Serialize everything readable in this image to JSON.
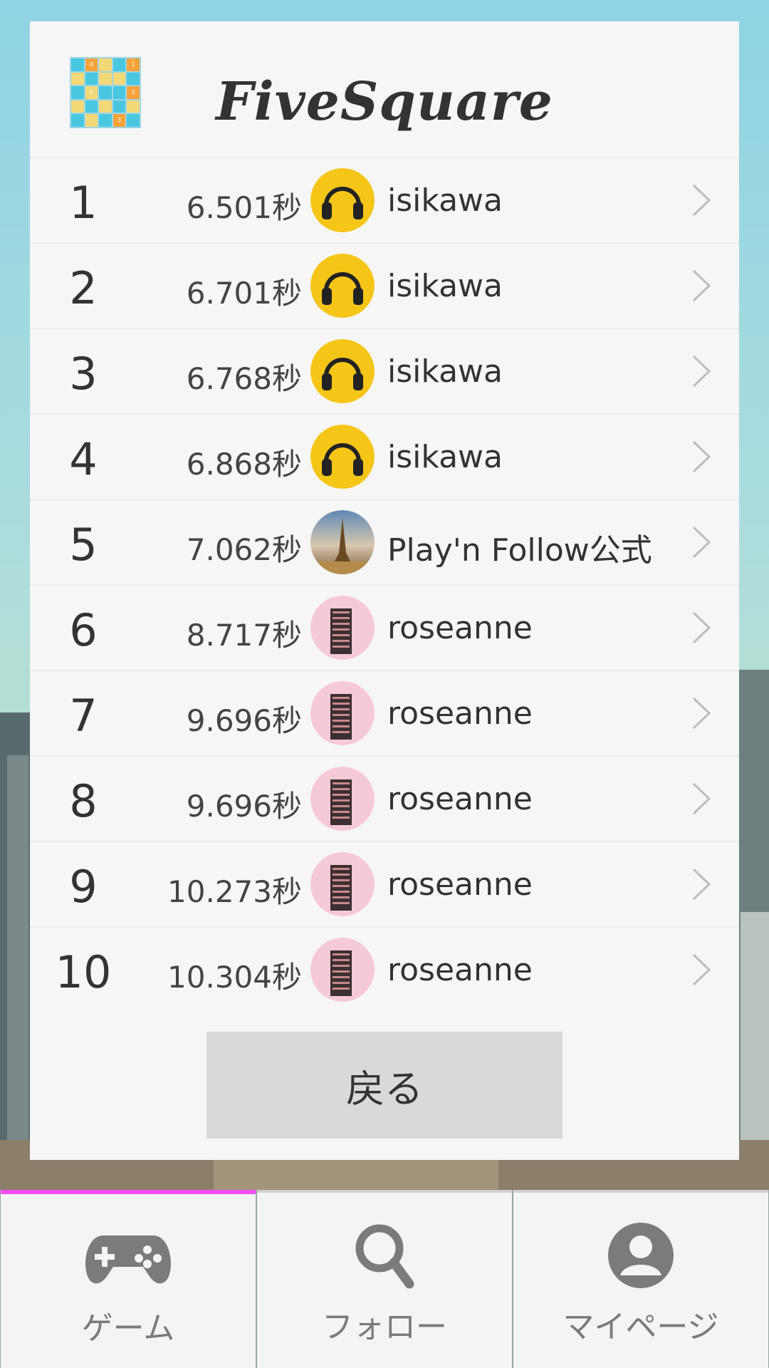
{
  "app": {
    "title": "FiveSquare"
  },
  "logo": {
    "cells": [
      {
        "c": "#49c7e0",
        "t": ""
      },
      {
        "c": "#f7a23a",
        "t": "4"
      },
      {
        "c": "#f3d878",
        "t": ""
      },
      {
        "c": "#49c7e0",
        "t": ""
      },
      {
        "c": "#f7a23a",
        "t": "1"
      },
      {
        "c": "#f3d878",
        "t": ""
      },
      {
        "c": "#49c7e0",
        "t": ""
      },
      {
        "c": "#f3d878",
        "t": ""
      },
      {
        "c": "#f3d878",
        "t": ""
      },
      {
        "c": "#49c7e0",
        "t": ""
      },
      {
        "c": "#49c7e0",
        "t": ""
      },
      {
        "c": "#f3d878",
        "t": "5"
      },
      {
        "c": "#49c7e0",
        "t": ""
      },
      {
        "c": "#49c7e0",
        "t": ""
      },
      {
        "c": "#f7a23a",
        "t": "2"
      },
      {
        "c": "#f3d878",
        "t": ""
      },
      {
        "c": "#49c7e0",
        "t": ""
      },
      {
        "c": "#f3d878",
        "t": ""
      },
      {
        "c": "#49c7e0",
        "t": ""
      },
      {
        "c": "#f3d878",
        "t": ""
      },
      {
        "c": "#49c7e0",
        "t": ""
      },
      {
        "c": "#f3d878",
        "t": ""
      },
      {
        "c": "#49c7e0",
        "t": ""
      },
      {
        "c": "#f7a23a",
        "t": "3"
      },
      {
        "c": "#49c7e0",
        "t": ""
      }
    ]
  },
  "rankings": [
    {
      "rank": "1",
      "time": "6.501秒",
      "user": "isikawa",
      "avatar": "headphones-avatar"
    },
    {
      "rank": "2",
      "time": "6.701秒",
      "user": "isikawa",
      "avatar": "headphones-avatar"
    },
    {
      "rank": "3",
      "time": "6.768秒",
      "user": "isikawa",
      "avatar": "headphones-avatar"
    },
    {
      "rank": "4",
      "time": "6.868秒",
      "user": "isikawa",
      "avatar": "headphones-avatar"
    },
    {
      "rank": "5",
      "time": "7.062秒",
      "user": "Play'n Follow公式",
      "avatar": "eiffel-tower-avatar"
    },
    {
      "rank": "6",
      "time": "8.717秒",
      "user": "roseanne",
      "avatar": "building-avatar"
    },
    {
      "rank": "7",
      "time": "9.696秒",
      "user": "roseanne",
      "avatar": "building-avatar"
    },
    {
      "rank": "8",
      "time": "9.696秒",
      "user": "roseanne",
      "avatar": "building-avatar"
    },
    {
      "rank": "9",
      "time": "10.273秒",
      "user": "roseanne",
      "avatar": "building-avatar"
    },
    {
      "rank": "10",
      "time": "10.304秒",
      "user": "roseanne",
      "avatar": "building-avatar"
    }
  ],
  "back_button": {
    "label": "戻る"
  },
  "tabbar": {
    "tabs": [
      {
        "label": "ゲーム",
        "icon": "gamepad-icon",
        "active": true
      },
      {
        "label": "フォロー",
        "icon": "search-icon",
        "active": false
      },
      {
        "label": "マイページ",
        "icon": "account-icon",
        "active": false
      }
    ]
  },
  "colors": {
    "accent": "#f04ff0",
    "avatar_yellow": "#f5c518",
    "avatar_pink": "#f6c9d6"
  }
}
